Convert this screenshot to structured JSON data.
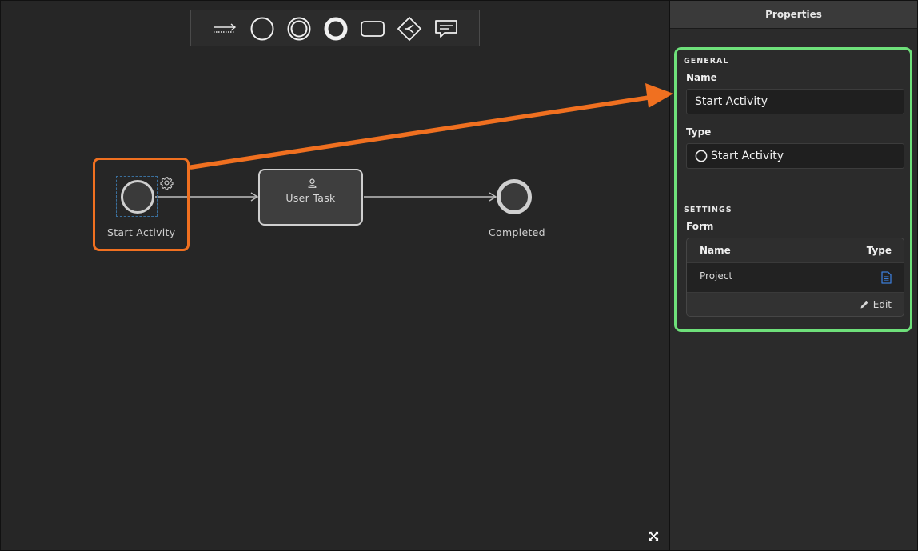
{
  "toolbar": {
    "tools": [
      {
        "icon": "sequence-flow-icon"
      },
      {
        "icon": "start-event-icon"
      },
      {
        "icon": "intermediate-event-icon"
      },
      {
        "icon": "end-event-icon"
      },
      {
        "icon": "task-icon"
      },
      {
        "icon": "gateway-icon"
      },
      {
        "icon": "annotation-icon"
      }
    ]
  },
  "diagram": {
    "start_label": "Start Activity",
    "task_label": "User Task",
    "end_label": "Completed"
  },
  "properties": {
    "title": "Properties",
    "general": {
      "section": "GENERAL",
      "name_label": "Name",
      "name_value": "Start Activity",
      "type_label": "Type",
      "type_value": "Start Activity"
    },
    "settings": {
      "section": "SETTINGS",
      "form_label": "Form",
      "table": {
        "col_name": "Name",
        "col_type": "Type",
        "rows": [
          {
            "name": "Project",
            "type_icon": "document-icon"
          }
        ],
        "edit_label": "Edit"
      }
    }
  },
  "colors": {
    "highlight_orange": "#f07020",
    "highlight_green": "#6ee07a",
    "doc_icon_blue": "#3b7bd6"
  }
}
